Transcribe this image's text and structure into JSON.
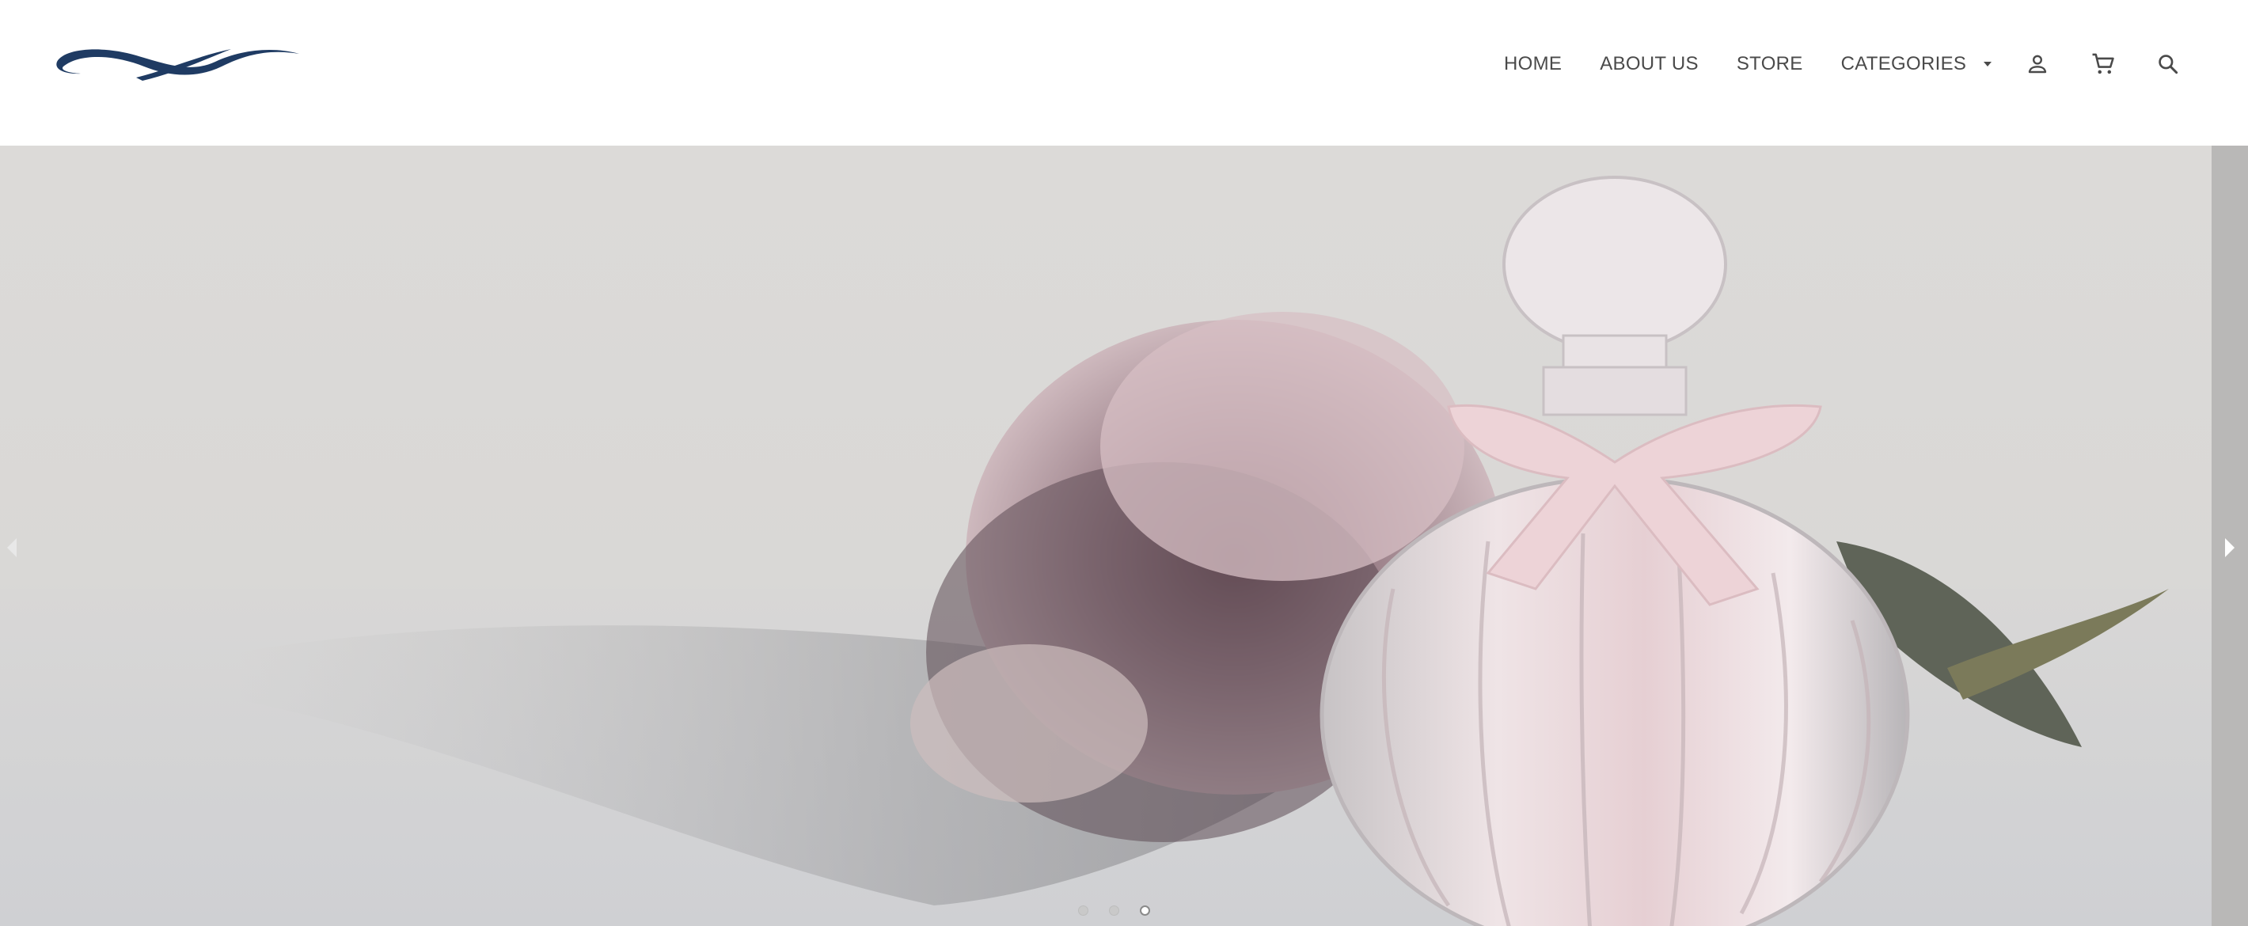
{
  "header": {
    "logo_icon": "swoosh-logo-icon",
    "brand_color": "#1f3b63",
    "nav": [
      {
        "label": "HOME"
      },
      {
        "label": "ABOUT US"
      },
      {
        "label": "STORE"
      },
      {
        "label": "CATEGORIES",
        "has_dropdown": true
      }
    ],
    "icons": [
      "account-icon",
      "cart-icon",
      "search-icon"
    ]
  },
  "hero": {
    "description_icon": "perfume-bottle-with-peony-image",
    "prev_icon": "chevron-left-icon",
    "next_icon": "chevron-right-icon",
    "slides_total": 3,
    "active_slide": 3
  }
}
